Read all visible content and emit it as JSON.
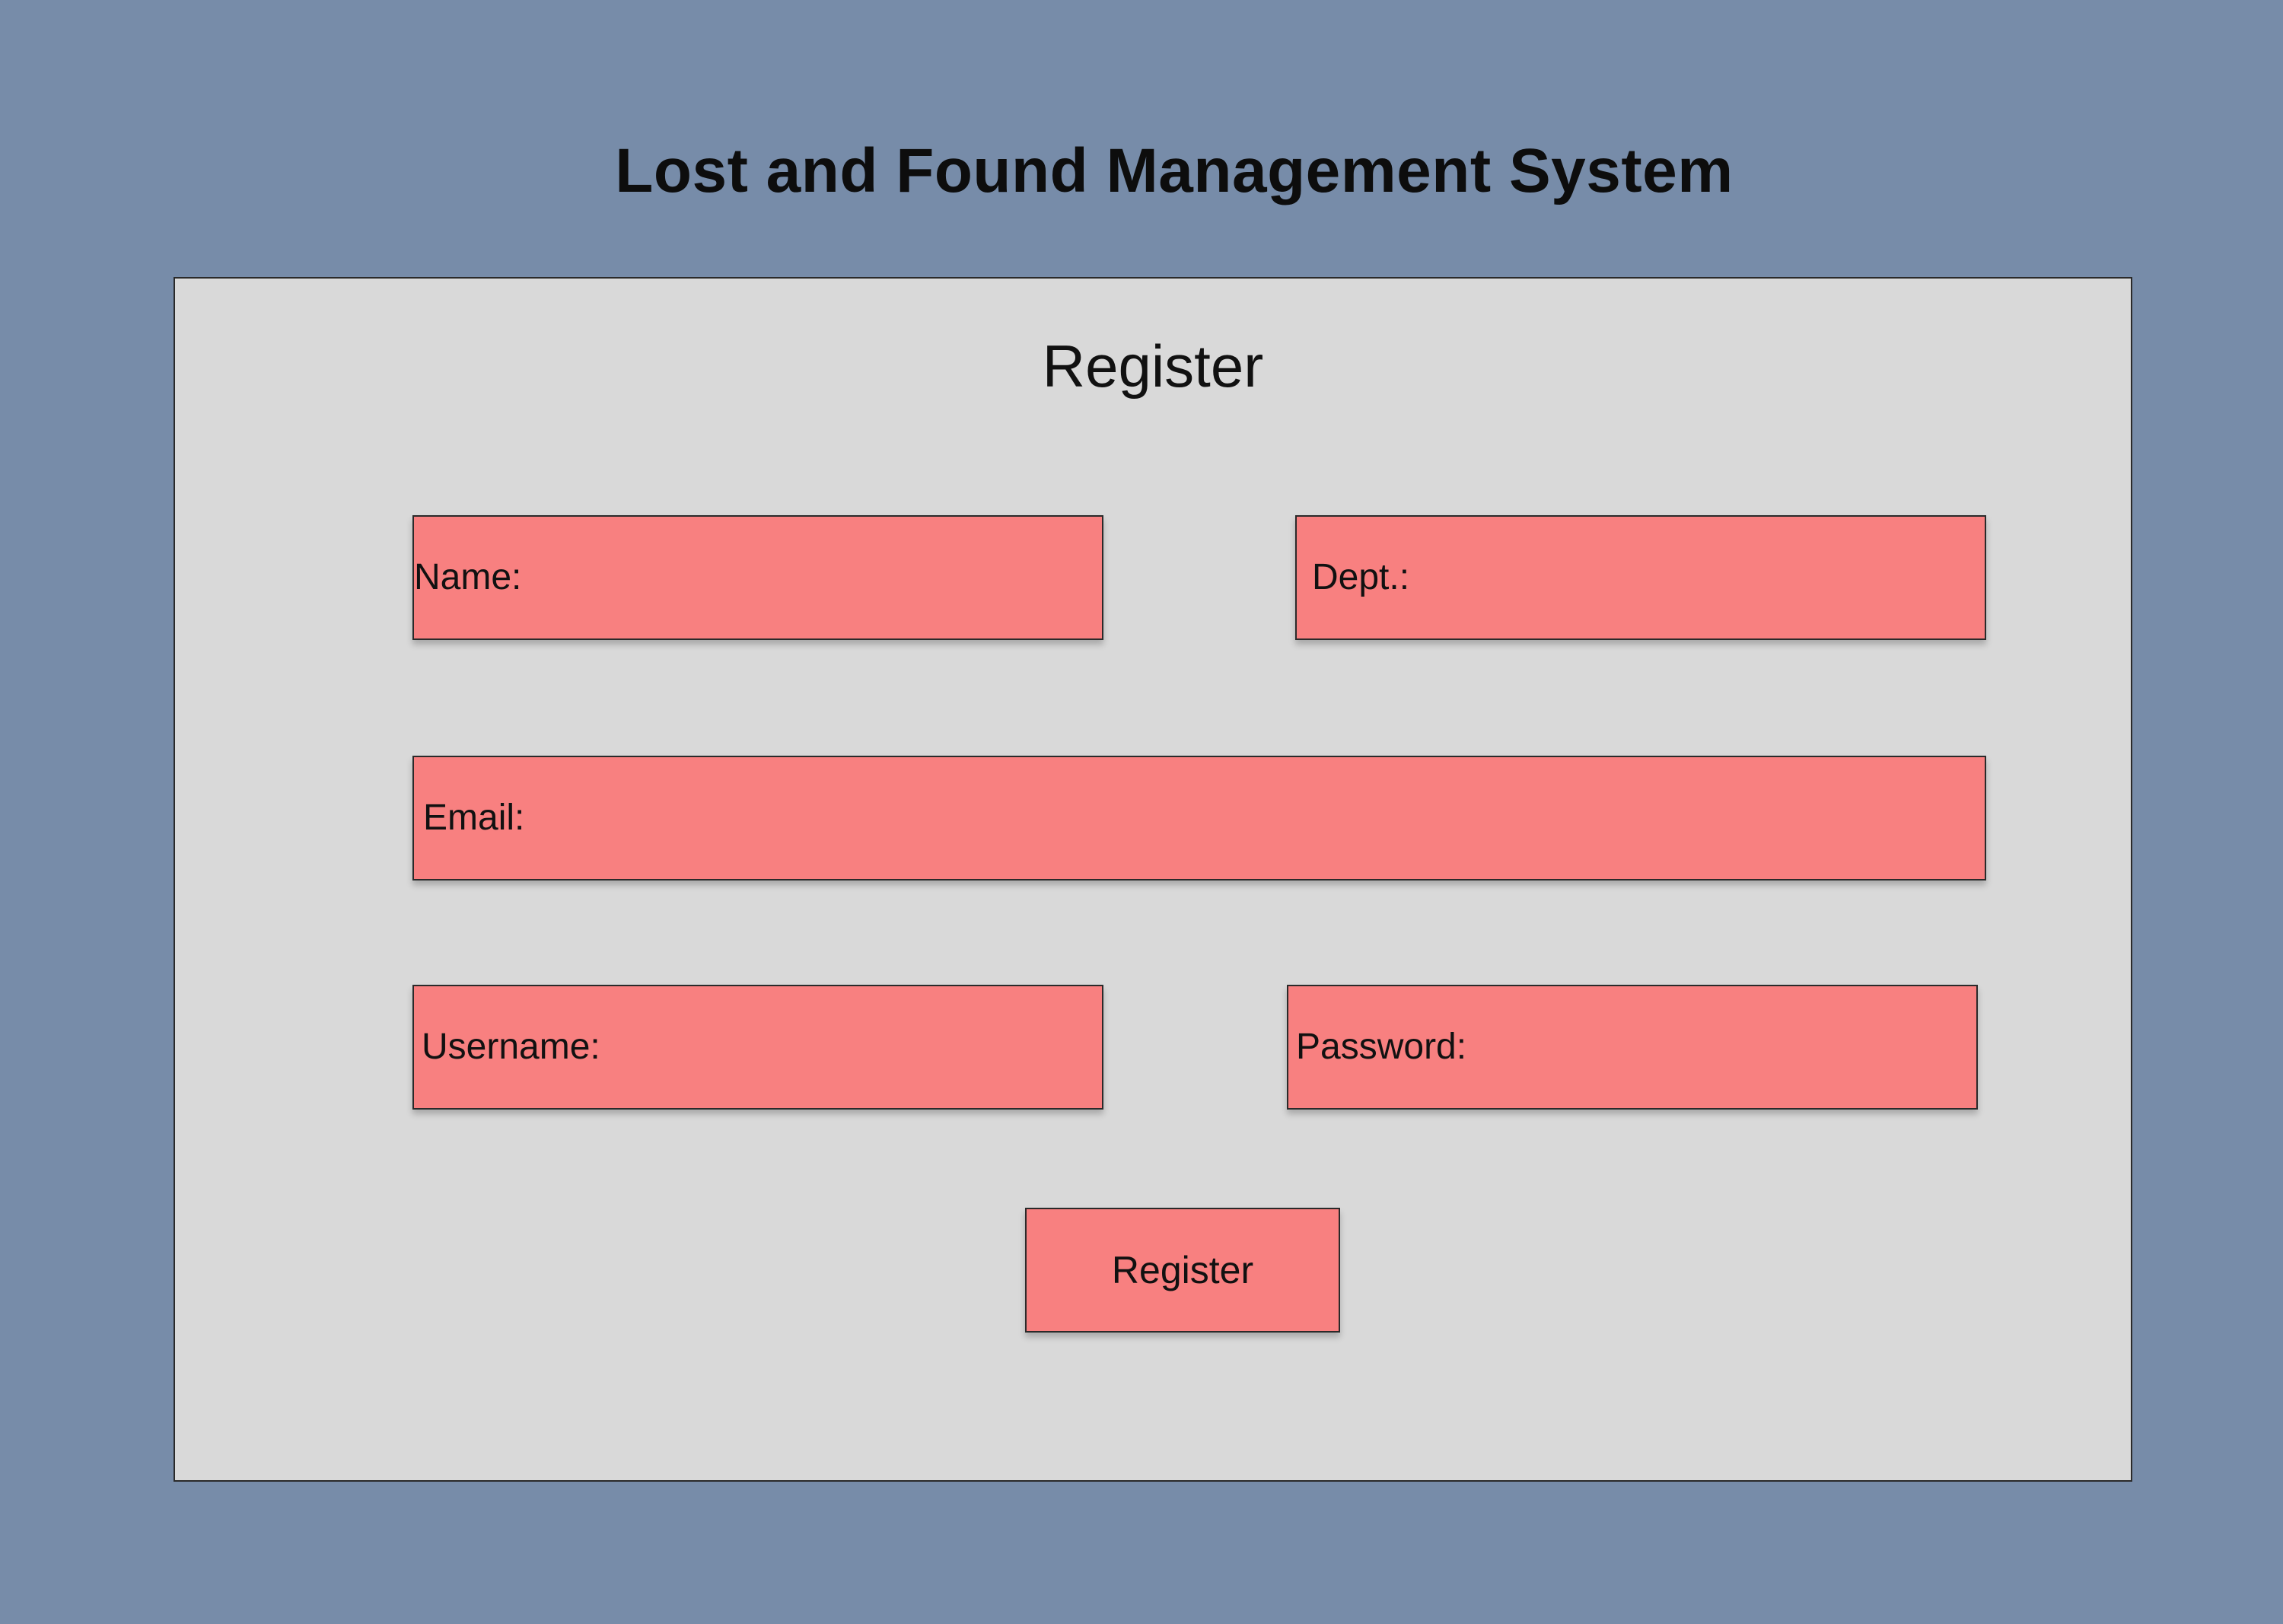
{
  "app": {
    "title": "Lost and Found Management System"
  },
  "form": {
    "title": "Register",
    "fields": {
      "name": {
        "label": "Name:",
        "value": ""
      },
      "dept": {
        "label": "Dept.:",
        "value": ""
      },
      "email": {
        "label": "Email:",
        "value": ""
      },
      "username": {
        "label": "Username:",
        "value": ""
      },
      "password": {
        "label": "Password:",
        "value": ""
      }
    },
    "submit_label": "Register"
  },
  "colors": {
    "page_background": "#778ca9",
    "panel_background": "#d9d9d9",
    "field_background": "#f88080",
    "border": "#2a2a2a"
  }
}
